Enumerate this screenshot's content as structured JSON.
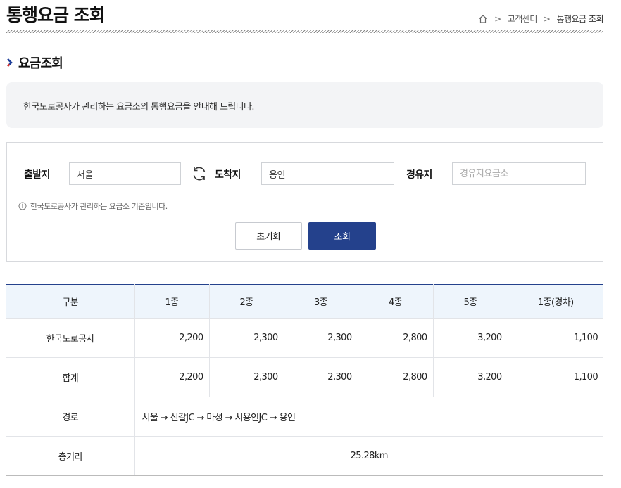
{
  "page": {
    "title": "통행요금 조회"
  },
  "breadcrumb": {
    "home_icon": "home-icon",
    "level1": "고객센터",
    "current": "통행요금 조회"
  },
  "section": {
    "title": "요금조회"
  },
  "notice": {
    "text": "한국도로공사가 관리하는 요금소의 통행요금을 안내해 드립니다."
  },
  "search": {
    "departure_label": "출발지",
    "departure_value": "서울",
    "arrival_label": "도착지",
    "arrival_value": "용인",
    "via_label": "경유지",
    "via_placeholder": "경유지요금소",
    "swap_icon": "swap-icon",
    "hint": "한국도로공사가 관리하는 요금소 기준입니다.",
    "reset_label": "초기화",
    "search_label": "조회"
  },
  "colors": {
    "accent": "#24418c",
    "header_bg": "#eef5fc",
    "notice_bg": "#f3f4f6"
  },
  "table": {
    "headers": [
      "구분",
      "1종",
      "2종",
      "3종",
      "4종",
      "5종",
      "1종(경차)"
    ],
    "rows": [
      {
        "label": "한국도로공사",
        "values": [
          "2,200",
          "2,300",
          "2,300",
          "2,800",
          "3,200",
          "1,100"
        ]
      },
      {
        "label": "합계",
        "values": [
          "2,200",
          "2,300",
          "2,300",
          "2,800",
          "3,200",
          "1,100"
        ]
      }
    ],
    "route_label": "경로",
    "route_value": "서울 → 신갈JC → 마성 → 서용인JC → 용인",
    "distance_label": "총거리",
    "distance_value": "25.28km"
  }
}
